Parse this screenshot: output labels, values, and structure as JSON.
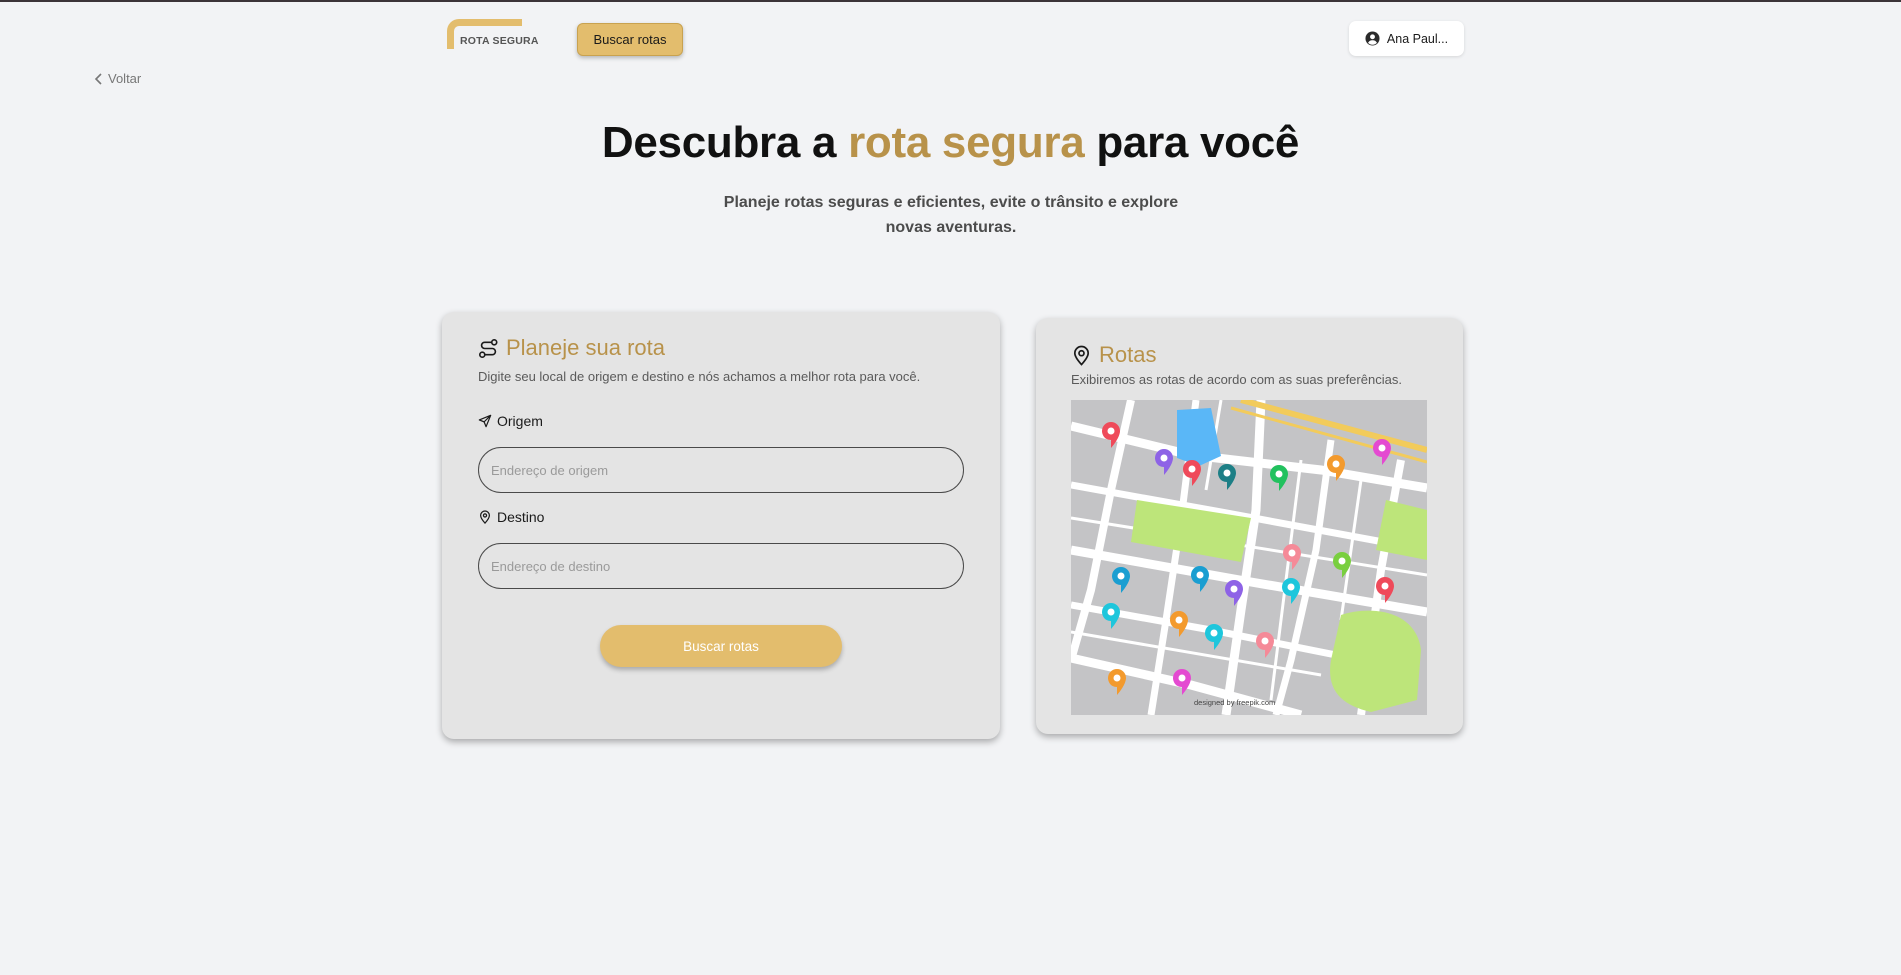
{
  "header": {
    "logo_text": "ROTA SEGURA",
    "nav_button": "Buscar rotas",
    "user_name": "Ana Paul..."
  },
  "back": {
    "label": "Voltar"
  },
  "hero": {
    "title_pre": "Descubra a ",
    "title_accent": "rota segura",
    "title_post": " para você",
    "subtitle": "Planeje rotas seguras e eficientes, evite o trânsito e explore novas aventuras."
  },
  "plan_card": {
    "title": "Planeje sua rota",
    "description": "Digite seu local de origem e destino e nós achamos a melhor rota para você.",
    "origin_label": "Origem",
    "origin_placeholder": "Endereço de origem",
    "origin_value": "",
    "destination_label": "Destino",
    "destination_placeholder": "Endereço de destino",
    "destination_value": "",
    "submit_label": "Buscar rotas"
  },
  "routes_card": {
    "title": "Rotas",
    "description": "Exibiremos as rotas de acordo com as suas preferências.",
    "map_credit": "designed by freepik.com"
  },
  "colors": {
    "accent": "#e3bd6d",
    "accent_text": "#b8924a",
    "background": "#f2f3f5",
    "card": "#e4e4e4"
  },
  "icons": {
    "user": "user-circle-icon",
    "back": "chevron-left-icon",
    "route": "route-icon",
    "origin": "send-icon",
    "destination": "map-pin-icon",
    "routes": "map-pin-icon"
  }
}
